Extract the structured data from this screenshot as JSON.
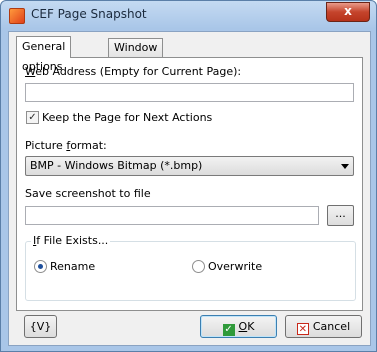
{
  "window": {
    "title": "CEF Page Snapshot",
    "close_glyph": "x"
  },
  "tabs": [
    {
      "label": "General options",
      "active": true
    },
    {
      "label": "Window size",
      "active": false
    }
  ],
  "web_address": {
    "label_accel": "W",
    "label_rest": "eb Address (Empty for Current Page):",
    "value": ""
  },
  "keep_page": {
    "label": "Keep the Page for Next Actions",
    "checked": true,
    "check_glyph": "✓"
  },
  "picture_format": {
    "label_pre": "Picture ",
    "label_accel": "f",
    "label_rest": "ormat:",
    "selected": "BMP - Windows Bitmap (*.bmp)"
  },
  "save_file": {
    "label": "Save screenshot to file",
    "value": "",
    "browse_label": "..."
  },
  "if_exists": {
    "title_accel": "I",
    "title_rest": "f File Exists...",
    "options": [
      {
        "label": "Rename",
        "selected": true
      },
      {
        "label": "Overwrite",
        "selected": false
      }
    ]
  },
  "buttons": {
    "variables_label": "{V}",
    "ok_accel": "O",
    "ok_rest": "K",
    "cancel_label": "Cancel",
    "ok_icon_glyph": "✓",
    "cancel_icon_glyph": "✕"
  }
}
